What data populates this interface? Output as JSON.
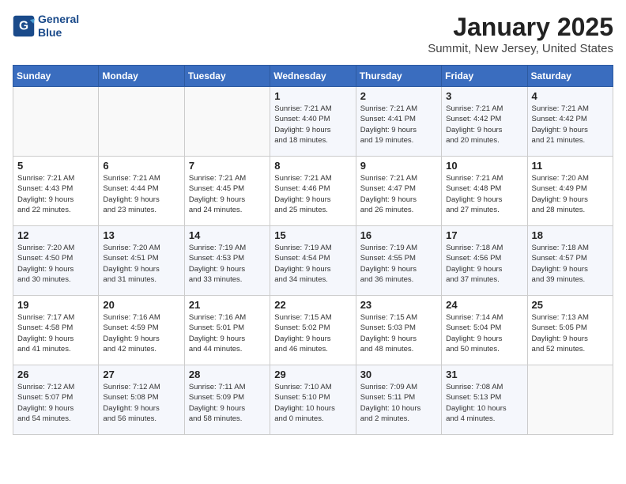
{
  "header": {
    "logo_line1": "General",
    "logo_line2": "Blue",
    "month": "January 2025",
    "location": "Summit, New Jersey, United States"
  },
  "weekdays": [
    "Sunday",
    "Monday",
    "Tuesday",
    "Wednesday",
    "Thursday",
    "Friday",
    "Saturday"
  ],
  "weeks": [
    [
      {
        "day": "",
        "info": ""
      },
      {
        "day": "",
        "info": ""
      },
      {
        "day": "",
        "info": ""
      },
      {
        "day": "1",
        "info": "Sunrise: 7:21 AM\nSunset: 4:40 PM\nDaylight: 9 hours\nand 18 minutes."
      },
      {
        "day": "2",
        "info": "Sunrise: 7:21 AM\nSunset: 4:41 PM\nDaylight: 9 hours\nand 19 minutes."
      },
      {
        "day": "3",
        "info": "Sunrise: 7:21 AM\nSunset: 4:42 PM\nDaylight: 9 hours\nand 20 minutes."
      },
      {
        "day": "4",
        "info": "Sunrise: 7:21 AM\nSunset: 4:42 PM\nDaylight: 9 hours\nand 21 minutes."
      }
    ],
    [
      {
        "day": "5",
        "info": "Sunrise: 7:21 AM\nSunset: 4:43 PM\nDaylight: 9 hours\nand 22 minutes."
      },
      {
        "day": "6",
        "info": "Sunrise: 7:21 AM\nSunset: 4:44 PM\nDaylight: 9 hours\nand 23 minutes."
      },
      {
        "day": "7",
        "info": "Sunrise: 7:21 AM\nSunset: 4:45 PM\nDaylight: 9 hours\nand 24 minutes."
      },
      {
        "day": "8",
        "info": "Sunrise: 7:21 AM\nSunset: 4:46 PM\nDaylight: 9 hours\nand 25 minutes."
      },
      {
        "day": "9",
        "info": "Sunrise: 7:21 AM\nSunset: 4:47 PM\nDaylight: 9 hours\nand 26 minutes."
      },
      {
        "day": "10",
        "info": "Sunrise: 7:21 AM\nSunset: 4:48 PM\nDaylight: 9 hours\nand 27 minutes."
      },
      {
        "day": "11",
        "info": "Sunrise: 7:20 AM\nSunset: 4:49 PM\nDaylight: 9 hours\nand 28 minutes."
      }
    ],
    [
      {
        "day": "12",
        "info": "Sunrise: 7:20 AM\nSunset: 4:50 PM\nDaylight: 9 hours\nand 30 minutes."
      },
      {
        "day": "13",
        "info": "Sunrise: 7:20 AM\nSunset: 4:51 PM\nDaylight: 9 hours\nand 31 minutes."
      },
      {
        "day": "14",
        "info": "Sunrise: 7:19 AM\nSunset: 4:53 PM\nDaylight: 9 hours\nand 33 minutes."
      },
      {
        "day": "15",
        "info": "Sunrise: 7:19 AM\nSunset: 4:54 PM\nDaylight: 9 hours\nand 34 minutes."
      },
      {
        "day": "16",
        "info": "Sunrise: 7:19 AM\nSunset: 4:55 PM\nDaylight: 9 hours\nand 36 minutes."
      },
      {
        "day": "17",
        "info": "Sunrise: 7:18 AM\nSunset: 4:56 PM\nDaylight: 9 hours\nand 37 minutes."
      },
      {
        "day": "18",
        "info": "Sunrise: 7:18 AM\nSunset: 4:57 PM\nDaylight: 9 hours\nand 39 minutes."
      }
    ],
    [
      {
        "day": "19",
        "info": "Sunrise: 7:17 AM\nSunset: 4:58 PM\nDaylight: 9 hours\nand 41 minutes."
      },
      {
        "day": "20",
        "info": "Sunrise: 7:16 AM\nSunset: 4:59 PM\nDaylight: 9 hours\nand 42 minutes."
      },
      {
        "day": "21",
        "info": "Sunrise: 7:16 AM\nSunset: 5:01 PM\nDaylight: 9 hours\nand 44 minutes."
      },
      {
        "day": "22",
        "info": "Sunrise: 7:15 AM\nSunset: 5:02 PM\nDaylight: 9 hours\nand 46 minutes."
      },
      {
        "day": "23",
        "info": "Sunrise: 7:15 AM\nSunset: 5:03 PM\nDaylight: 9 hours\nand 48 minutes."
      },
      {
        "day": "24",
        "info": "Sunrise: 7:14 AM\nSunset: 5:04 PM\nDaylight: 9 hours\nand 50 minutes."
      },
      {
        "day": "25",
        "info": "Sunrise: 7:13 AM\nSunset: 5:05 PM\nDaylight: 9 hours\nand 52 minutes."
      }
    ],
    [
      {
        "day": "26",
        "info": "Sunrise: 7:12 AM\nSunset: 5:07 PM\nDaylight: 9 hours\nand 54 minutes."
      },
      {
        "day": "27",
        "info": "Sunrise: 7:12 AM\nSunset: 5:08 PM\nDaylight: 9 hours\nand 56 minutes."
      },
      {
        "day": "28",
        "info": "Sunrise: 7:11 AM\nSunset: 5:09 PM\nDaylight: 9 hours\nand 58 minutes."
      },
      {
        "day": "29",
        "info": "Sunrise: 7:10 AM\nSunset: 5:10 PM\nDaylight: 10 hours\nand 0 minutes."
      },
      {
        "day": "30",
        "info": "Sunrise: 7:09 AM\nSunset: 5:11 PM\nDaylight: 10 hours\nand 2 minutes."
      },
      {
        "day": "31",
        "info": "Sunrise: 7:08 AM\nSunset: 5:13 PM\nDaylight: 10 hours\nand 4 minutes."
      },
      {
        "day": "",
        "info": ""
      }
    ]
  ]
}
